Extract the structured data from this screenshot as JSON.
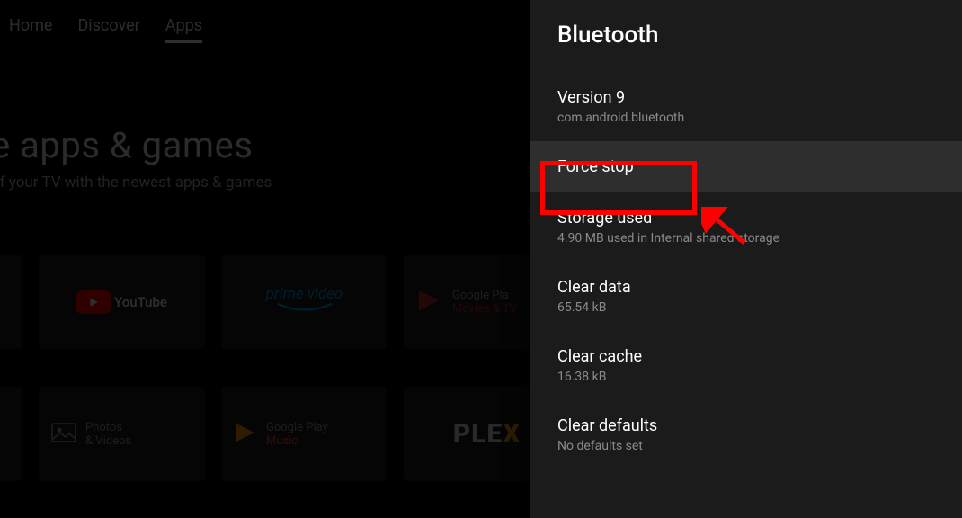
{
  "bg": {
    "tabs": [
      "Home",
      "Discover",
      "Apps"
    ],
    "active_tab": "Apps",
    "hero_title": "e apps & games",
    "hero_sub": "of your TV with the newest apps & games",
    "tiles_row1": {
      "youtube": "YouTube",
      "prime": "prime video",
      "gplay_movies_l1": "Google Pla",
      "gplay_movies_l2": "Movies & TV"
    },
    "tiles_row2": {
      "photos_l1": "Photos",
      "photos_l2": "& Videos",
      "gplay_music_l1": "Google Play",
      "gplay_music_l2": "Music",
      "plex": "PLEX"
    }
  },
  "panel": {
    "title": "Bluetooth",
    "version": {
      "label": "Version 9",
      "sub": "com.android.bluetooth"
    },
    "force_stop": {
      "label": "Force stop"
    },
    "storage": {
      "label": "Storage used",
      "sub": "4.90 MB used in Internal shared storage"
    },
    "clear_data": {
      "label": "Clear data",
      "sub": "65.54 kB"
    },
    "clear_cache": {
      "label": "Clear cache",
      "sub": "16.38 kB"
    },
    "clear_defaults": {
      "label": "Clear defaults",
      "sub": "No defaults set"
    }
  }
}
